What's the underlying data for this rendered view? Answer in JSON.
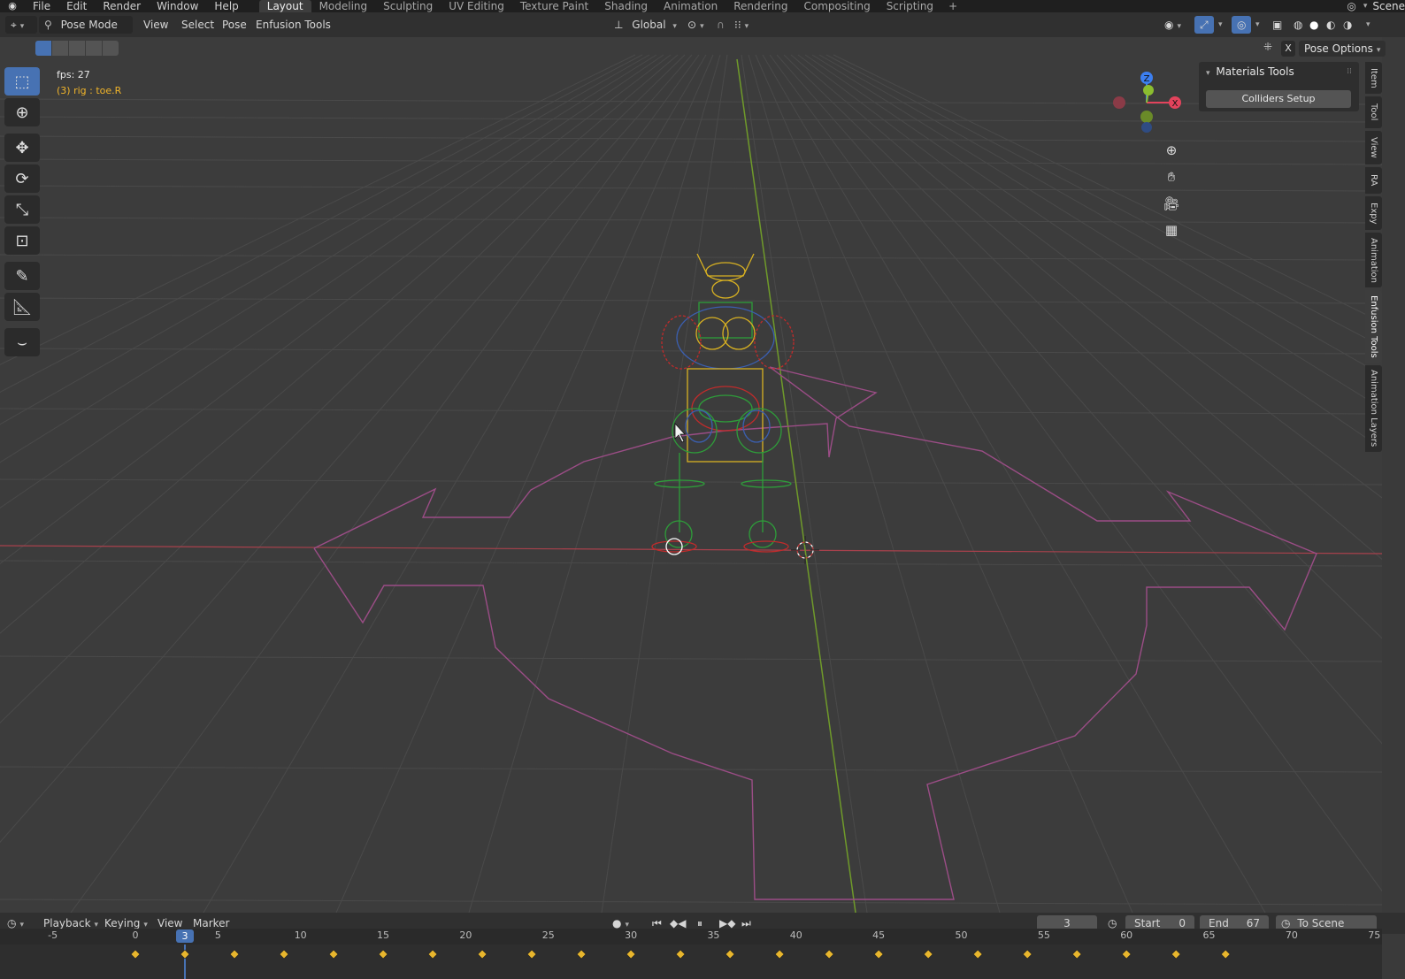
{
  "topbar": {
    "menus": [
      "File",
      "Edit",
      "Render",
      "Window",
      "Help"
    ],
    "workspaces": [
      "Layout",
      "Modeling",
      "Sculpting",
      "UV Editing",
      "Texture Paint",
      "Shading",
      "Animation",
      "Rendering",
      "Compositing",
      "Scripting"
    ],
    "active_workspace": "Layout",
    "scene_label": "Scene"
  },
  "header": {
    "mode": "Pose Mode",
    "menus": [
      "View",
      "Select",
      "Pose",
      "Enfusion Tools"
    ],
    "orientation": "Global",
    "pose_options": "Pose Options",
    "x_label": "X"
  },
  "viewport": {
    "fps": "fps: 27",
    "object_info": "(3) rig : toe.R",
    "gizmo_axes": {
      "x": "X",
      "y": "Y",
      "z": "Z"
    },
    "axis_colors": {
      "x": "#e3435c",
      "y": "#8bbd2f",
      "z": "#3c7ff0"
    }
  },
  "toolbar": {
    "tools": [
      "select-box",
      "cursor",
      "move",
      "rotate",
      "scale",
      "transform",
      "annotate",
      "measure",
      "curve-tool"
    ]
  },
  "sidebar": {
    "panel_title": "Materials Tools",
    "button": "Colliders Setup",
    "tabs": [
      "Item",
      "Tool",
      "View",
      "RA",
      "Expy",
      "Animation",
      "Enfusion Tools",
      "Animation Layers"
    ],
    "active_tab": "Enfusion Tools"
  },
  "timeline": {
    "menus": [
      "Playback",
      "Keying",
      "View",
      "Marker"
    ],
    "current_frame": "3",
    "start_label": "Start",
    "start_value": "0",
    "end_label": "End",
    "end_value": "67",
    "scene_range": "To Scene Range",
    "ruler": [
      "-5",
      "0",
      "5",
      "10",
      "15",
      "20",
      "25",
      "30",
      "35",
      "40",
      "45",
      "50",
      "55",
      "60",
      "65",
      "70",
      "75"
    ],
    "playhead": "3"
  },
  "colors": {
    "accent": "#4772b3",
    "keyframe": "#e8b62d",
    "selected_text": "#f0b42a"
  }
}
